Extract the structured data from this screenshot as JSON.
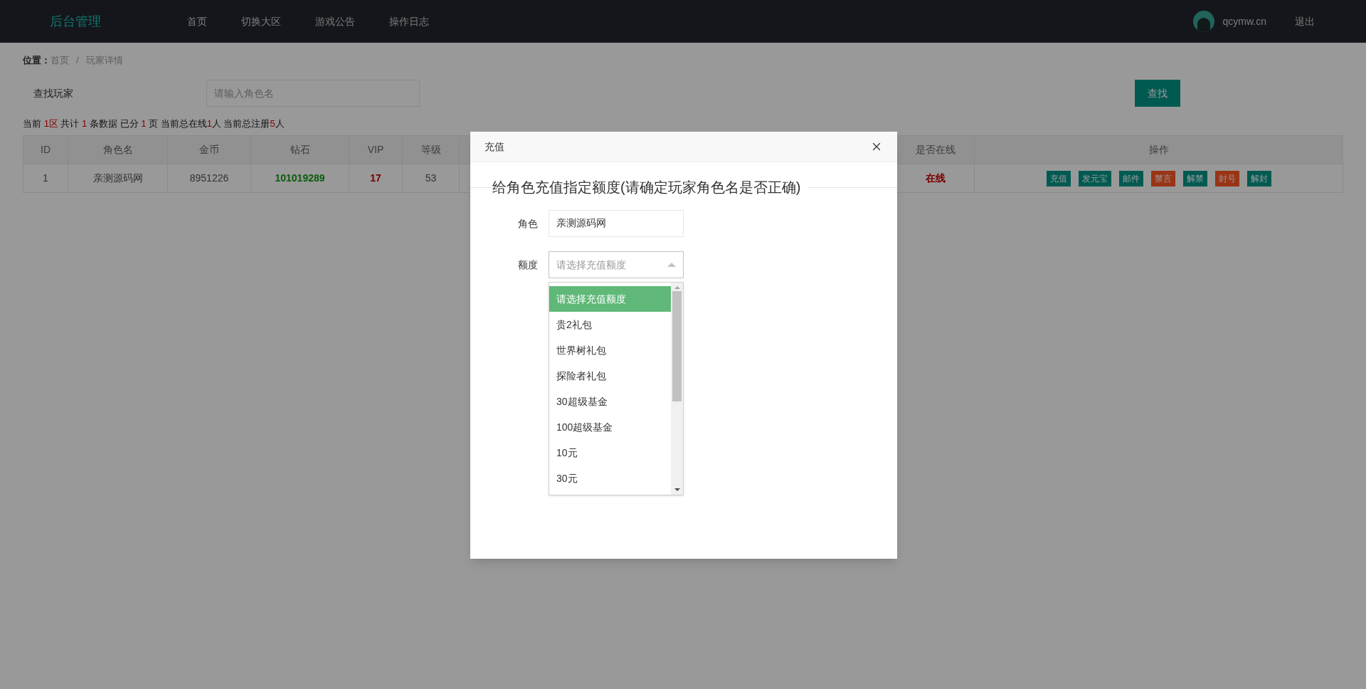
{
  "header": {
    "logo": "后台管理",
    "nav": [
      "首页",
      "切换大区",
      "游戏公告",
      "操作日志"
    ],
    "user": "qcymw.cn",
    "logout": "退出"
  },
  "breadcrumb": {
    "label": "位置：",
    "items": [
      "首页",
      "玩家详情"
    ],
    "separator": "/"
  },
  "search": {
    "label": "查找玩家",
    "placeholder": "请输入角色名",
    "button": "查找"
  },
  "summary": [
    {
      "text": "当前 ",
      "highlight": false
    },
    {
      "text": "1区",
      "highlight": true
    },
    {
      "text": " 共计 ",
      "highlight": false
    },
    {
      "text": "1",
      "highlight": true
    },
    {
      "text": " 条数据 已分 ",
      "highlight": false
    },
    {
      "text": "1",
      "highlight": true
    },
    {
      "text": " 页 当前总在线",
      "highlight": false
    },
    {
      "text": "1",
      "highlight": true
    },
    {
      "text": "人 当前总注册",
      "highlight": false
    },
    {
      "text": "5",
      "highlight": true
    },
    {
      "text": "人",
      "highlight": false
    }
  ],
  "table": {
    "columns": [
      "ID",
      "角色名",
      "金币",
      "钻石",
      "VIP",
      "等级",
      "是否在线",
      "操作"
    ],
    "rows": [
      {
        "cells": [
          {
            "text": "1",
            "kind": "plain"
          },
          {
            "text": "亲测源码网",
            "kind": "plain"
          },
          {
            "text": "8951226",
            "kind": "plain"
          },
          {
            "text": "101019289",
            "kind": "positive"
          },
          {
            "text": "17",
            "kind": "alert"
          },
          {
            "text": "53",
            "kind": "plain"
          },
          {
            "text": "在线",
            "kind": "alert"
          }
        ],
        "actions": [
          {
            "label": "充值",
            "kind": "normal"
          },
          {
            "label": "发元宝",
            "kind": "normal"
          },
          {
            "label": "邮件",
            "kind": "normal"
          },
          {
            "label": "禁言",
            "kind": "danger"
          },
          {
            "label": "解禁",
            "kind": "normal"
          },
          {
            "label": "封号",
            "kind": "danger"
          },
          {
            "label": "解封",
            "kind": "normal"
          }
        ]
      }
    ]
  },
  "modal": {
    "title": "充值",
    "legend": "给角色充值指定额度(请确定玩家角色名是否正确)",
    "fields": [
      {
        "label": "角色",
        "value": "亲测源码网"
      }
    ],
    "select": {
      "label": "额度",
      "placeholder": "请选择充值额度",
      "open": true,
      "options": [
        {
          "label": "请选择充值额度",
          "selected": true
        },
        {
          "label": "贵2礼包",
          "selected": false
        },
        {
          "label": "世界树礼包",
          "selected": false
        },
        {
          "label": "探险者礼包",
          "selected": false
        },
        {
          "label": "30超级基金",
          "selected": false
        },
        {
          "label": "100超级基金",
          "selected": false
        },
        {
          "label": "10元",
          "selected": false
        },
        {
          "label": "30元",
          "selected": false
        }
      ]
    }
  }
}
